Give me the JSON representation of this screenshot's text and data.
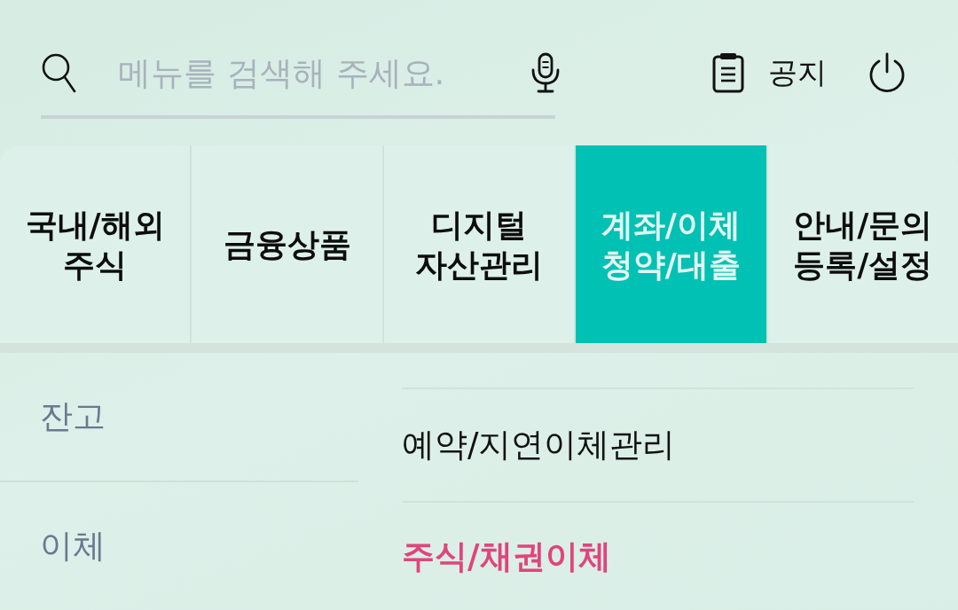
{
  "search": {
    "placeholder": "메뉴를 검색해 주세요."
  },
  "notice": {
    "label": "공지"
  },
  "tabs": [
    {
      "lines": [
        "국내/해외",
        "주식"
      ],
      "selected": false
    },
    {
      "lines": [
        "금융상품"
      ],
      "selected": false
    },
    {
      "lines": [
        "디지털",
        "자산관리"
      ],
      "selected": false
    },
    {
      "lines": [
        "계좌/이체",
        "청약/대출"
      ],
      "selected": true
    },
    {
      "lines": [
        "안내/문의",
        "등록/설정"
      ],
      "selected": false
    }
  ],
  "sidebar": {
    "items": [
      {
        "label": "잔고"
      },
      {
        "label": "이체"
      }
    ]
  },
  "menu": {
    "items": [
      {
        "label": "예약/지연이체관리",
        "selected": false
      },
      {
        "label": "주식/채권이체",
        "selected": true
      }
    ]
  }
}
